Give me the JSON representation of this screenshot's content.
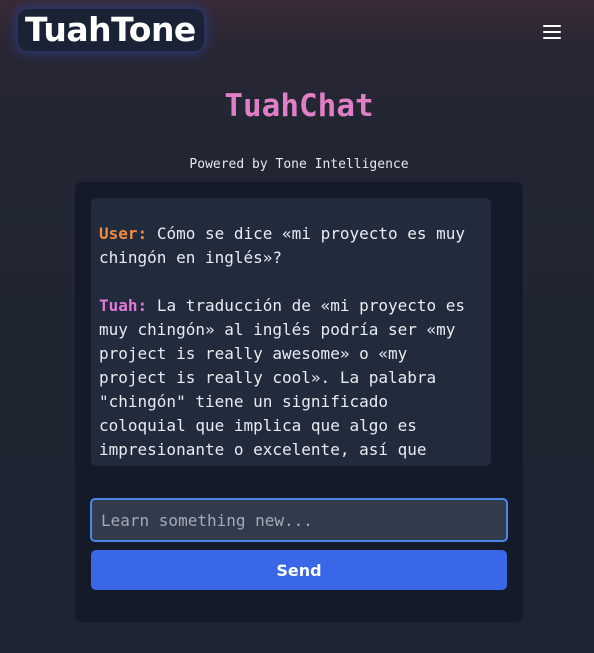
{
  "header": {
    "logo_text": "TuahTone",
    "menu_icon": "hamburger-menu-icon"
  },
  "chat": {
    "title": "TuahChat",
    "subtitle": "Powered by Tone Intelligence",
    "messages": [
      {
        "speaker": "User:",
        "text": "Cómo se dice «mi proyecto es muy chingón en inglés»?"
      },
      {
        "speaker": "Tuah:",
        "text": "La traducción de «mi proyecto es muy chingón» al inglés podría ser «my project is really awesome» o «my project is really cool». La palabra \"chingón\" tiene un significado coloquial que implica que algo es impresionante o excelente, así que estas opciones capturan ese sentido."
      }
    ]
  },
  "composer": {
    "placeholder": "Learn something new...",
    "value": "",
    "send_label": "Send"
  },
  "colors": {
    "title": "#e07fc6",
    "user_label": "#f08a3c",
    "tuah_label": "#e079d8",
    "send_button": "#3a66e8",
    "input_border": "#4a86e8"
  }
}
